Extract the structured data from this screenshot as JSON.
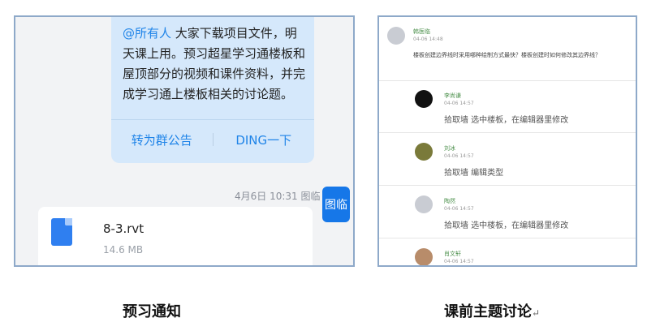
{
  "left": {
    "bubble": {
      "mention": "@所有人",
      "message": " 大家下载项目文件，明天课上用。预习超星学习通楼板和屋顶部分的视频和课件资料，并完成学习通上楼板相关的讨论题。",
      "action_announce": "转为群公告",
      "action_ding": "DING一下"
    },
    "meta": "4月6日 10:31 图临",
    "avatar_text": "图临",
    "file": {
      "name": "8-3.rvt",
      "size": "14.6 MB",
      "icon": "file-icon"
    }
  },
  "right": {
    "post": {
      "author": "韩医临",
      "time": "04-06 14:48",
      "question": "楼板创建边界线时采用哪种绘制方式最快？楼板创建时如何修改其边界线？"
    },
    "replies": [
      {
        "name": "李尚谦",
        "time": "04-06 14:57",
        "text": "拾取墙 选中楼板，在编辑器里修改",
        "avatar_color": "#111111"
      },
      {
        "name": "刘冰",
        "time": "04-06 14:57",
        "text": "拾取墙 编辑类型",
        "avatar_color": "#7a7a3a"
      },
      {
        "name": "陶然",
        "time": "04-06 14:57",
        "text": "拾取墙 选中楼板，在编辑器里修改",
        "avatar_color": "#c9ccd3"
      },
      {
        "name": "肖文轩",
        "time": "04-06 14:57",
        "text": "",
        "avatar_color": "#b88c6a"
      }
    ]
  },
  "captions": {
    "left": "预习通知",
    "right": "课前主题讨论",
    "mark": "↵"
  }
}
